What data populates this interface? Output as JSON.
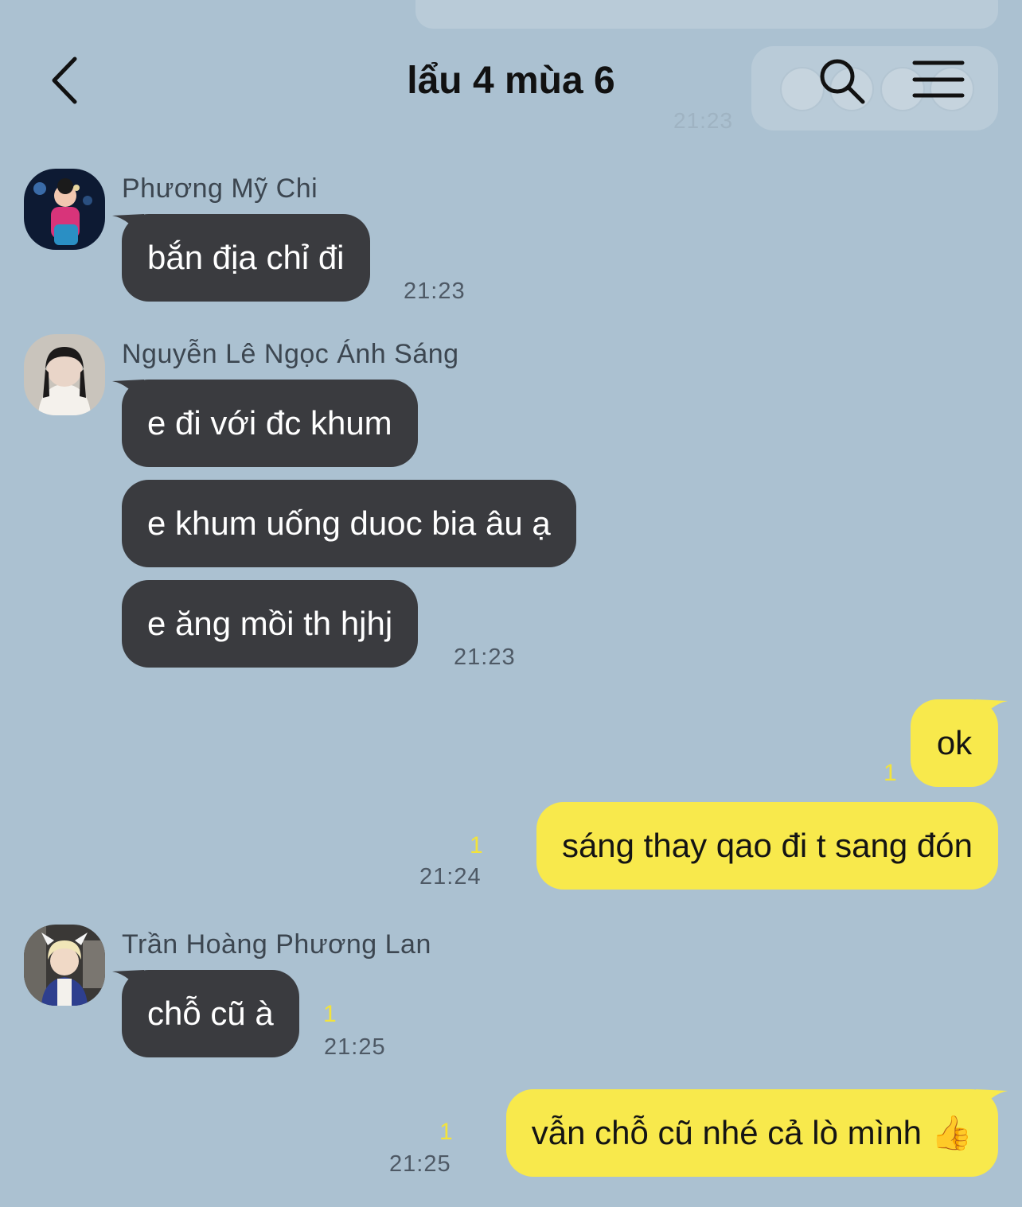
{
  "header": {
    "title": "lẩu 4 mùa 6",
    "back_icon": "chevron-left-icon",
    "search_icon": "search-icon",
    "menu_icon": "menu-icon"
  },
  "background_remnants": {
    "time": "21:23"
  },
  "colors": {
    "background": "#abc1d1",
    "incoming_bubble": "#3a3b3f",
    "outgoing_bubble": "#f8e94c",
    "unread_marker": "#f3e33a"
  },
  "messages": [
    {
      "sender": "Phương Mỹ Chi",
      "avatar": "avatar-image",
      "bubbles": [
        "bắn địa chỉ đi"
      ],
      "time": "21:23"
    },
    {
      "sender": "Nguyễn Lê Ngọc Ánh Sáng",
      "avatar": "avatar-image",
      "bubbles": [
        "e đi với đc khum",
        "e khum uống duoc bia âu ạ",
        "e ăng mồi th hjhj"
      ],
      "time": "21:23"
    },
    {
      "outgoing": true,
      "bubbles": [
        "ok",
        "sáng thay qao đi t sang đón"
      ],
      "unread": [
        "1",
        "1"
      ],
      "time": "21:24"
    },
    {
      "sender": "Trần Hoàng Phương Lan",
      "avatar": "avatar-image",
      "bubbles": [
        "chỗ cũ à"
      ],
      "unread": "1",
      "time": "21:25"
    },
    {
      "outgoing": true,
      "bubbles": [
        "vẫn chỗ cũ nhé cả lò mình 👍"
      ],
      "unread": "1",
      "time": "21:25"
    }
  ]
}
